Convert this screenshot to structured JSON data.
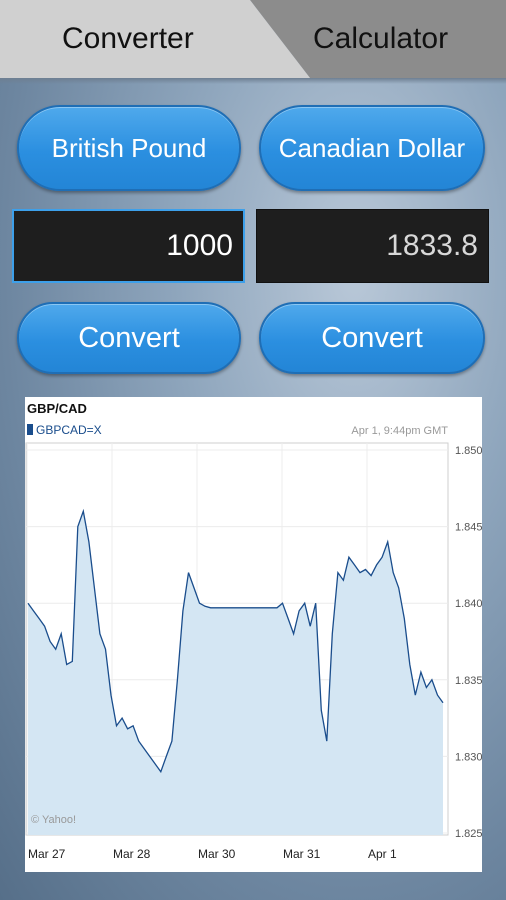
{
  "tabs": {
    "converter": "Converter",
    "calculator": "Calculator"
  },
  "currencies": {
    "from": "British Pound",
    "to": "Canadian Dollar"
  },
  "amounts": {
    "input": "1000",
    "result": "1833.8"
  },
  "buttons": {
    "convert_left": "Convert",
    "convert_right": "Convert"
  },
  "colors": {
    "button_blue": "#2b8fe0",
    "field_bg": "#1e1e1e",
    "chart_line": "#1a4d8c",
    "chart_fill": "#d4e6f3"
  },
  "chart_data": {
    "type": "area",
    "title": "GBP/CAD",
    "legend": "GBPCADX",
    "legend_text": "GBPCAD=X",
    "timestamp": "Apr 1, 9:44pm GMT",
    "credit": "© Yahoo!",
    "x_ticks": [
      "Mar 27",
      "Mar 28",
      "Mar 30",
      "Mar 31",
      "Apr 1"
    ],
    "y_ticks": [
      "1.850",
      "1.845",
      "1.840",
      "1.835",
      "1.830",
      "1.825"
    ],
    "ylim": [
      1.825,
      1.85
    ],
    "grid": true,
    "series": [
      {
        "values": [
          1.84,
          1.8395,
          1.839,
          1.8385,
          1.8375,
          1.837,
          1.838,
          1.836,
          1.8362,
          1.845,
          1.846,
          1.844,
          1.841,
          1.838,
          1.837,
          1.834,
          1.832,
          1.8325,
          1.8318,
          1.832,
          1.831,
          1.8305,
          1.83,
          1.8295,
          1.829,
          1.83,
          1.831,
          1.835,
          1.8395,
          1.842,
          1.841,
          1.84,
          1.8398,
          1.8397,
          1.8397,
          1.8397,
          1.8397,
          1.8397,
          1.8397,
          1.8397,
          1.8397,
          1.8397,
          1.8397,
          1.8397,
          1.8397,
          1.8397,
          1.84,
          1.839,
          1.838,
          1.8395,
          1.84,
          1.8385,
          1.84,
          1.833,
          1.831,
          1.838,
          1.842,
          1.8415,
          1.843,
          1.8425,
          1.842,
          1.8422,
          1.8418,
          1.8425,
          1.843,
          1.844,
          1.842,
          1.841,
          1.839,
          1.836,
          1.834,
          1.8355,
          1.8345,
          1.835,
          1.834,
          1.8335
        ]
      }
    ]
  }
}
